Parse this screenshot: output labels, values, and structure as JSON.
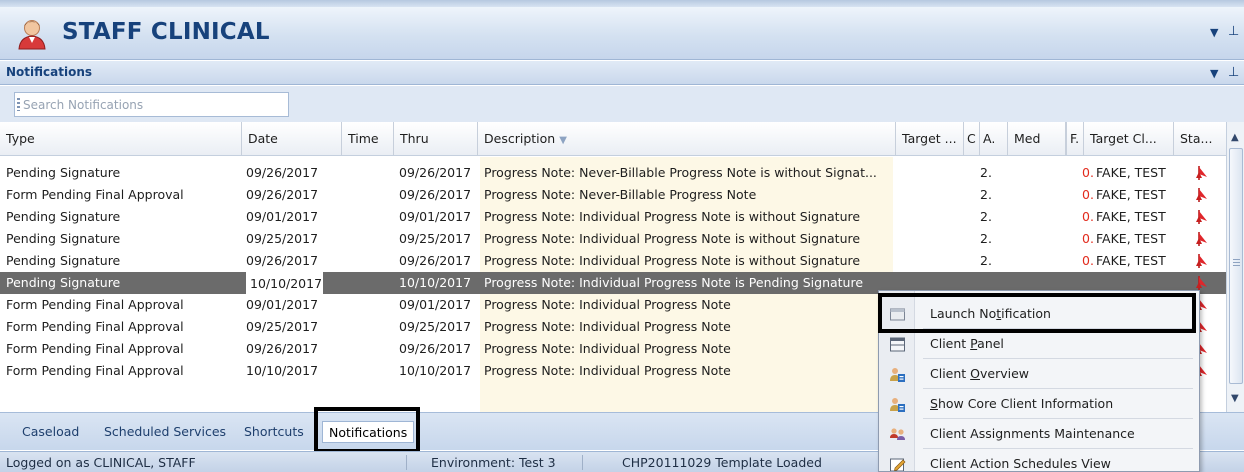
{
  "app": {
    "title": "STAFF CLINICAL",
    "pin_symbol": "▾ ⫬"
  },
  "notifications_pane": {
    "title": "Notifications",
    "search_placeholder": "Search Notifications"
  },
  "grid": {
    "columns": [
      "Type",
      "Date",
      "Time",
      "Thru",
      "Description",
      "Target ...",
      "C",
      "A.",
      "Med",
      "F.",
      "Target Cl...",
      "Sta..."
    ],
    "rows": [
      {
        "type": "Pending Signature",
        "date": "09/26/2017",
        "time": "",
        "thru": "09/26/2017",
        "description": "Progress Note: Never-Billable Progress Note is without Signat...",
        "a": "2.",
        "f": "0.",
        "client": "FAKE, TEST"
      },
      {
        "type": "Form Pending Final Approval",
        "date": "09/26/2017",
        "time": "",
        "thru": "09/26/2017",
        "description": "Progress Note: Never-Billable Progress Note",
        "a": "2.",
        "f": "0.",
        "client": "FAKE, TEST"
      },
      {
        "type": "Pending Signature",
        "date": "09/01/2017",
        "time": "",
        "thru": "09/01/2017",
        "description": "Progress Note: Individual Progress Note is without Signature",
        "a": "2.",
        "f": "0.",
        "client": "FAKE, TEST"
      },
      {
        "type": "Pending Signature",
        "date": "09/25/2017",
        "time": "",
        "thru": "09/25/2017",
        "description": "Progress Note: Individual Progress Note is without Signature",
        "a": "2.",
        "f": "0.",
        "client": "FAKE, TEST"
      },
      {
        "type": "Pending Signature",
        "date": "09/26/2017",
        "time": "",
        "thru": "09/26/2017",
        "description": "Progress Note: Individual Progress Note is without Signature",
        "a": "2.",
        "f": "0.",
        "client": "FAKE, TEST"
      },
      {
        "type": "Pending Signature",
        "date": "10/10/2017",
        "time": "",
        "thru": "10/10/2017",
        "description": "Progress Note: Individual Progress Note is Pending Signature",
        "a": "",
        "f": "",
        "client": ""
      },
      {
        "type": "Form Pending Final Approval",
        "date": "09/01/2017",
        "time": "",
        "thru": "09/01/2017",
        "description": "Progress Note: Individual Progress Note",
        "a": "",
        "f": "",
        "client": ""
      },
      {
        "type": "Form Pending Final Approval",
        "date": "09/25/2017",
        "time": "",
        "thru": "09/25/2017",
        "description": "Progress Note: Individual Progress Note",
        "a": "",
        "f": "",
        "client": ""
      },
      {
        "type": "Form Pending Final Approval",
        "date": "09/26/2017",
        "time": "",
        "thru": "09/26/2017",
        "description": "Progress Note: Individual Progress Note",
        "a": "",
        "f": "",
        "client": ""
      },
      {
        "type": "Form Pending Final Approval",
        "date": "10/10/2017",
        "time": "",
        "thru": "10/10/2017",
        "description": "Progress Note: Individual Progress Note",
        "a": "",
        "f": "",
        "client": ""
      }
    ],
    "selected_row_index": 5,
    "status_icon": "red-flag-icon"
  },
  "tabs": [
    {
      "label": "Caseload",
      "active": false
    },
    {
      "label": "Scheduled Services",
      "active": false
    },
    {
      "label": "Shortcuts",
      "active": false
    },
    {
      "label": "Notifications",
      "active": true
    }
  ],
  "status_bar": {
    "logged_on": "Logged on as CLINICAL, STAFF",
    "environment": "Environment: Test 3",
    "template": "CHP20111029 Template Loaded"
  },
  "context_menu": {
    "items": [
      {
        "label_pre": "Launch No",
        "label_acc": "t",
        "label_post": "ification",
        "icon": "window-icon"
      },
      {
        "label_pre": "Client ",
        "label_acc": "P",
        "label_post": "anel",
        "icon": "panel-icon"
      },
      {
        "label_pre": "Client ",
        "label_acc": "O",
        "label_post": "verview",
        "icon": "client-icon"
      },
      {
        "label_pre": "",
        "label_acc": "S",
        "label_post": "how Core Client Information",
        "icon": "client-info-icon"
      },
      {
        "label_pre": "Client Assignments Maintenance",
        "label_acc": "",
        "label_post": "",
        "icon": "assignments-icon"
      },
      {
        "label_pre": "Client Action Schedules View",
        "label_acc": "",
        "label_post": "",
        "icon": "edit-schedule-icon"
      }
    ]
  }
}
